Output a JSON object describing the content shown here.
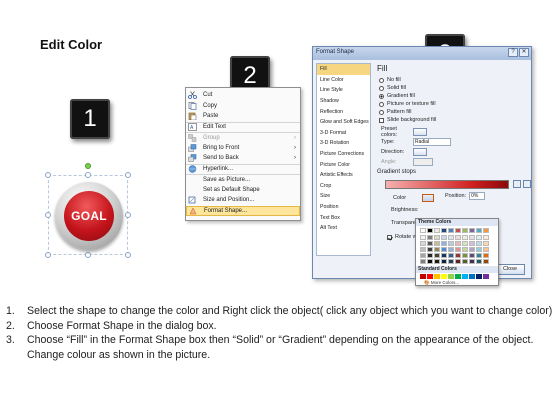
{
  "title": "Edit Color",
  "steps": [
    "1",
    "2",
    "3"
  ],
  "shape": {
    "label": "GOAL"
  },
  "context_menu": {
    "items": [
      {
        "label": "Cut",
        "icon": "scissors-icon"
      },
      {
        "label": "Copy",
        "icon": "copy-icon"
      },
      {
        "label": "Paste",
        "icon": "paste-icon"
      },
      {
        "label": "Edit Text",
        "icon": "edit-text-icon"
      },
      {
        "label": "Group",
        "icon": "group-icon",
        "submenu": true,
        "disabled": true
      },
      {
        "label": "Bring to Front",
        "icon": "bring-front-icon",
        "submenu": true
      },
      {
        "label": "Send to Back",
        "icon": "send-back-icon",
        "submenu": true
      },
      {
        "label": "Hyperlink...",
        "icon": "hyperlink-icon"
      },
      {
        "label": "Save as Picture...",
        "icon": ""
      },
      {
        "label": "Set as Default Shape",
        "icon": ""
      },
      {
        "label": "Size and Position...",
        "icon": "size-position-icon"
      },
      {
        "label": "Format Shape...",
        "icon": "format-shape-icon",
        "highlighted": true
      }
    ]
  },
  "dialog": {
    "title": "Format Shape",
    "categories": [
      "Fill",
      "Line Color",
      "Line Style",
      "Shadow",
      "Reflection",
      "Glow and Soft Edges",
      "3-D Format",
      "3-D Rotation",
      "Picture Corrections",
      "Picture Color",
      "Artistic Effects",
      "Crop",
      "Size",
      "Position",
      "Text Box",
      "Alt Text"
    ],
    "active_category": "Fill",
    "fill_heading": "Fill",
    "fill_options": [
      {
        "label": "No fill",
        "selected": false
      },
      {
        "label": "Solid fill",
        "selected": false
      },
      {
        "label": "Gradient fill",
        "selected": true
      },
      {
        "label": "Picture or texture fill",
        "selected": false
      },
      {
        "label": "Pattern fill",
        "selected": false
      }
    ],
    "slide_background_label": "Slide background fill",
    "preset_colors_label": "Preset colors:",
    "type_label": "Type:",
    "type_value": "Radial",
    "direction_label": "Direction:",
    "angle_label": "Angle:",
    "gradient_stops_label": "Gradient stops",
    "color_label": "Color",
    "position_label": "Position:",
    "position_value": "0%",
    "brightness_label": "Brightness:",
    "transparency_label": "Transparency:",
    "rotate_label": "Rotate with shape",
    "close_label": "Close"
  },
  "palette": {
    "theme_label": "Theme Colors",
    "standard_label": "Standard Colors",
    "more_label": "More Colors...",
    "theme_top": [
      "#ffffff",
      "#000000",
      "#eeece1",
      "#1f497d",
      "#4f81bd",
      "#c0504d",
      "#9bbb59",
      "#8064a2",
      "#4bacc6",
      "#f79646"
    ],
    "theme_shades": [
      [
        "#f2f2f2",
        "#7f7f7f",
        "#ddd9c3",
        "#c6d9f0",
        "#dbe5f1",
        "#f2dcdb",
        "#ebf1dd",
        "#e5e0ec",
        "#dbeef3",
        "#fdeada"
      ],
      [
        "#d8d8d8",
        "#595959",
        "#c4bd97",
        "#8db3e2",
        "#b8cce4",
        "#e5b9b7",
        "#d7e3bc",
        "#ccc1d9",
        "#b7dde8",
        "#fbd5b5"
      ],
      [
        "#bfbfbf",
        "#3f3f3f",
        "#938953",
        "#548dd4",
        "#95b3d7",
        "#d99694",
        "#c3d69b",
        "#b2a2c7",
        "#92cddc",
        "#fac08f"
      ],
      [
        "#a5a5a5",
        "#262626",
        "#494429",
        "#17365d",
        "#366092",
        "#953734",
        "#76923c",
        "#5f497a",
        "#31859b",
        "#e36c09"
      ],
      [
        "#7f7f7f",
        "#0c0c0c",
        "#1d1b10",
        "#0f243e",
        "#244061",
        "#632423",
        "#4f6128",
        "#3f3151",
        "#205867",
        "#974806"
      ]
    ],
    "standard": [
      "#c00000",
      "#ff0000",
      "#ffc000",
      "#ffff00",
      "#92d050",
      "#00b050",
      "#00b0f0",
      "#0070c0",
      "#002060",
      "#7030a0"
    ]
  },
  "instructions": [
    {
      "num": "1.",
      "text": "Select the shape to change the color and Right click the object( click any object which you want to change color)"
    },
    {
      "num": "2.",
      "text": "Choose Format Shape in the dialog box."
    },
    {
      "num": "3.",
      "text": "Choose “Fill” in the Format Shape box then “Solid” or “Gradient” depending on the appearance of the object. Change colour as shown in the picture."
    }
  ],
  "colors": {
    "goal_red": "#c4141c",
    "menu_highlight": "#fde59c",
    "dialog_title": "#a9bfdf"
  }
}
